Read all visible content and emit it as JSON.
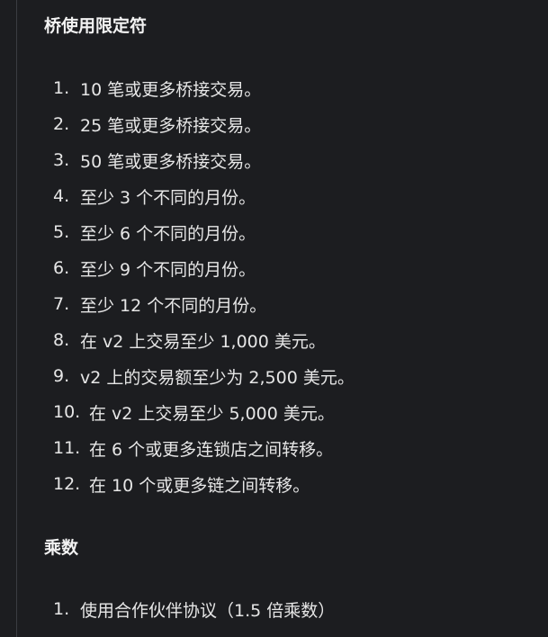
{
  "sections": [
    {
      "heading": "桥使用限定符",
      "items": [
        {
          "number": "1.",
          "text": "10 笔或更多桥接交易。"
        },
        {
          "number": "2.",
          "text": "25 笔或更多桥接交易。"
        },
        {
          "number": "3.",
          "text": "50 笔或更多桥接交易。"
        },
        {
          "number": "4.",
          "text": "至少 3 个不同的月份。"
        },
        {
          "number": "5.",
          "text": "至少 6 个不同的月份。"
        },
        {
          "number": "6.",
          "text": "至少 9 个不同的月份。"
        },
        {
          "number": "7.",
          "text": "至少 12 个不同的月份。"
        },
        {
          "number": "8.",
          "text": "在 v2 上交易至少 1,000 美元。"
        },
        {
          "number": "9.",
          "text": "v2 上的交易额至少为 2,500 美元。"
        },
        {
          "number": "10.",
          "text": "在 v2 上交易至少 5,000 美元。"
        },
        {
          "number": "11.",
          "text": "在 6 个或更多连锁店之间转移。"
        },
        {
          "number": "12.",
          "text": "在 10 个或更多链之间转移。"
        }
      ]
    },
    {
      "heading": "乘数",
      "items": [
        {
          "number": "1.",
          "text": "使用合作伙伴协议（1.5 倍乘数）"
        }
      ]
    }
  ]
}
